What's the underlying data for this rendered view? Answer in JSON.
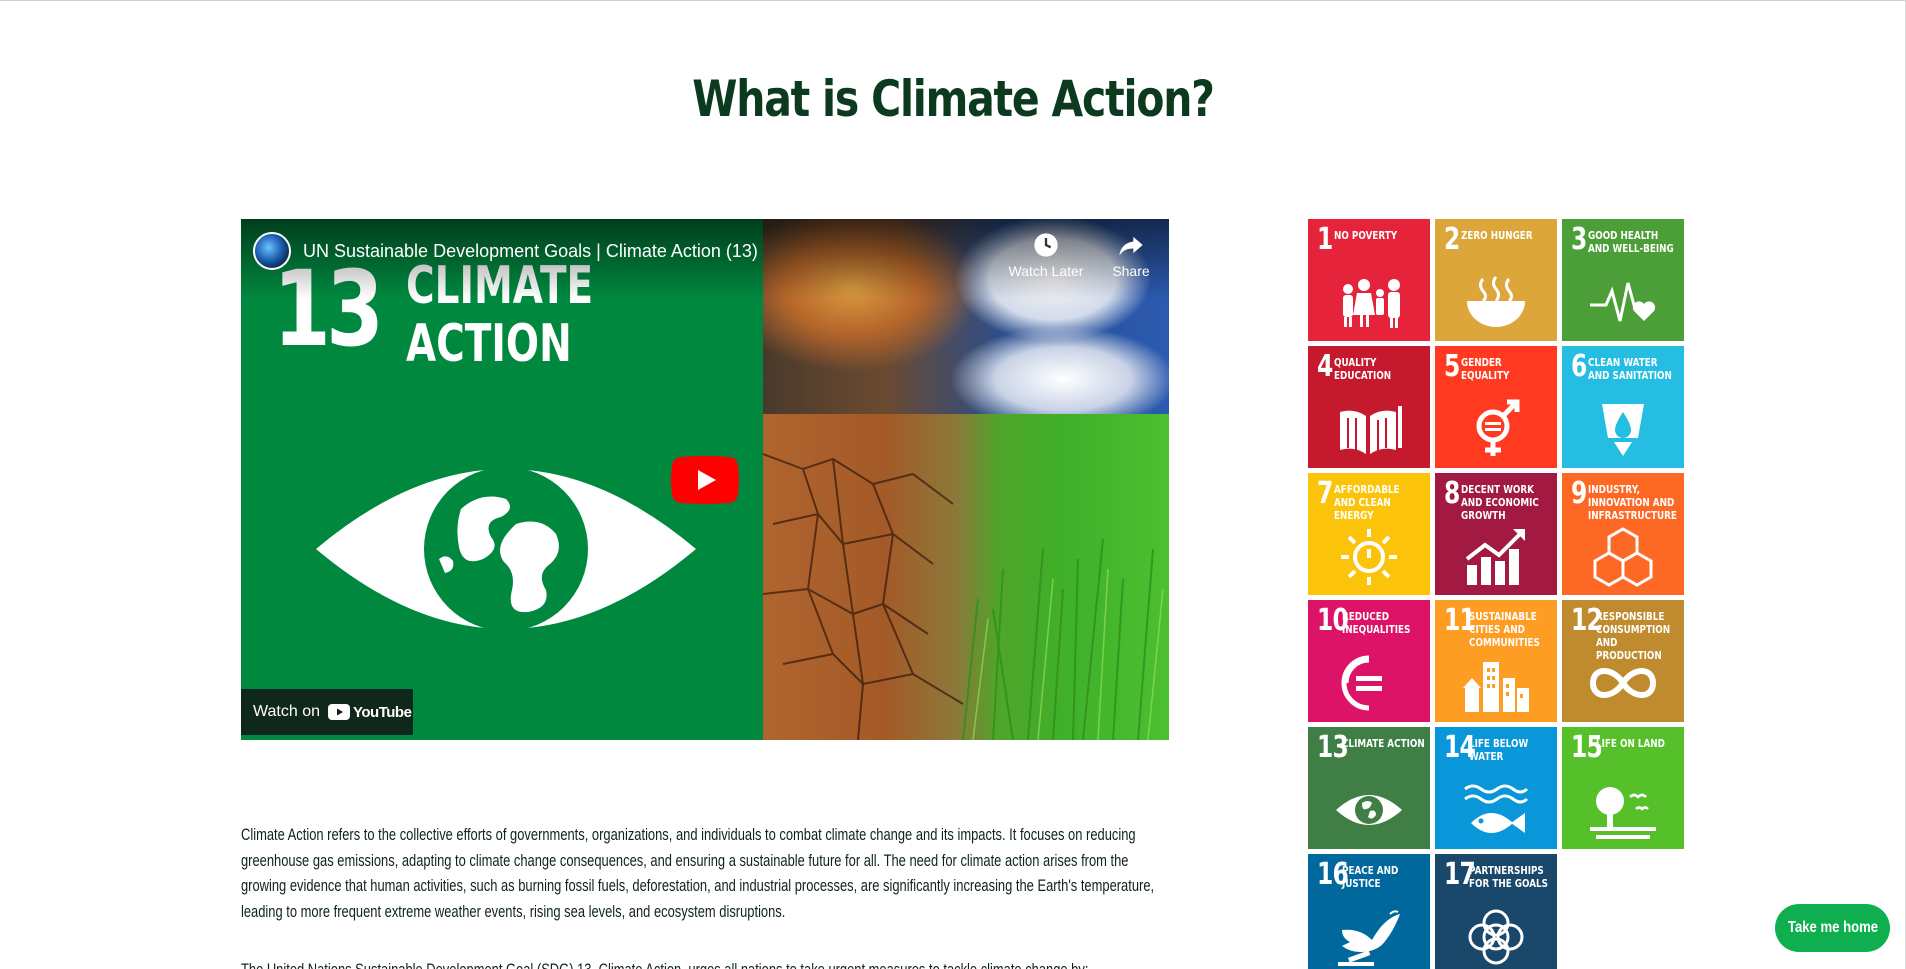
{
  "page": {
    "title": "What is Climate Action?"
  },
  "video": {
    "title": "UN Sustainable Development Goals | Climate Action (13)",
    "watch_later_label": "Watch Later",
    "share_label": "Share",
    "watch_on_label": "Watch on",
    "youtube_label": "YouTube",
    "thumbnail": {
      "goal_number": "13",
      "goal_line_1": "CLIMATE",
      "goal_line_2": "ACTION"
    }
  },
  "content": {
    "paragraph_1": "Climate Action refers to the collective efforts of governments, organizations, and individuals to combat climate change and its impacts. It focuses on reducing greenhouse gas emissions, adapting to climate change consequences, and ensuring a sustainable future for all. The need for climate action arises from the growing evidence that human activities, such as burning fossil fuels, deforestation, and industrial processes, are significantly increasing the Earth's temperature, leading to more frequent extreme weather events, rising sea levels, and ecosystem disruptions.",
    "paragraph_2": "The United Nations Sustainable Development Goal (SDG) 13, Climate Action, urges all nations to take urgent measures to tackle climate change by:"
  },
  "sdg_goals": [
    {
      "number": "1",
      "label": "No poverty",
      "color": "#e5243b",
      "icon": "family-icon"
    },
    {
      "number": "2",
      "label": "Zero hunger",
      "color": "#dda63a",
      "icon": "bowl-icon"
    },
    {
      "number": "3",
      "label": "Good health and well-being",
      "color": "#4c9f38",
      "icon": "heartbeat-icon"
    },
    {
      "number": "4",
      "label": "Quality education",
      "color": "#c5192d",
      "icon": "book-icon"
    },
    {
      "number": "5",
      "label": "Gender equality",
      "color": "#ff3a21",
      "icon": "gender-icon"
    },
    {
      "number": "6",
      "label": "Clean water and sanitation",
      "color": "#26bde2",
      "icon": "water-drop-icon"
    },
    {
      "number": "7",
      "label": "Affordable and clean energy",
      "color": "#fcc30b",
      "icon": "sun-power-icon"
    },
    {
      "number": "8",
      "label": "Decent work and economic growth",
      "color": "#a21942",
      "icon": "growth-chart-icon"
    },
    {
      "number": "9",
      "label": "Industry, innovation and infrastructure",
      "color": "#fd6925",
      "icon": "cubes-icon"
    },
    {
      "number": "10",
      "label": "Reduced inequalities",
      "color": "#dd1367",
      "icon": "equals-circle-icon"
    },
    {
      "number": "11",
      "label": "Sustainable cities and communities",
      "color": "#fd9d24",
      "icon": "buildings-icon"
    },
    {
      "number": "12",
      "label": "Responsible consumption and production",
      "color": "#bf8b2e",
      "icon": "infinity-icon"
    },
    {
      "number": "13",
      "label": "Climate action",
      "color": "#3f7e44",
      "icon": "eye-globe-icon"
    },
    {
      "number": "14",
      "label": "Life below water",
      "color": "#0a97d9",
      "icon": "fish-icon"
    },
    {
      "number": "15",
      "label": "Life on land",
      "color": "#56c02b",
      "icon": "tree-icon"
    },
    {
      "number": "16",
      "label": "Peace and justice",
      "color": "#00689d",
      "icon": "dove-icon"
    },
    {
      "number": "17",
      "label": "Partnerships for the goals",
      "color": "#19486a",
      "icon": "rings-icon"
    }
  ],
  "home_button": {
    "label": "Take me home",
    "color": "#0fae4e"
  }
}
